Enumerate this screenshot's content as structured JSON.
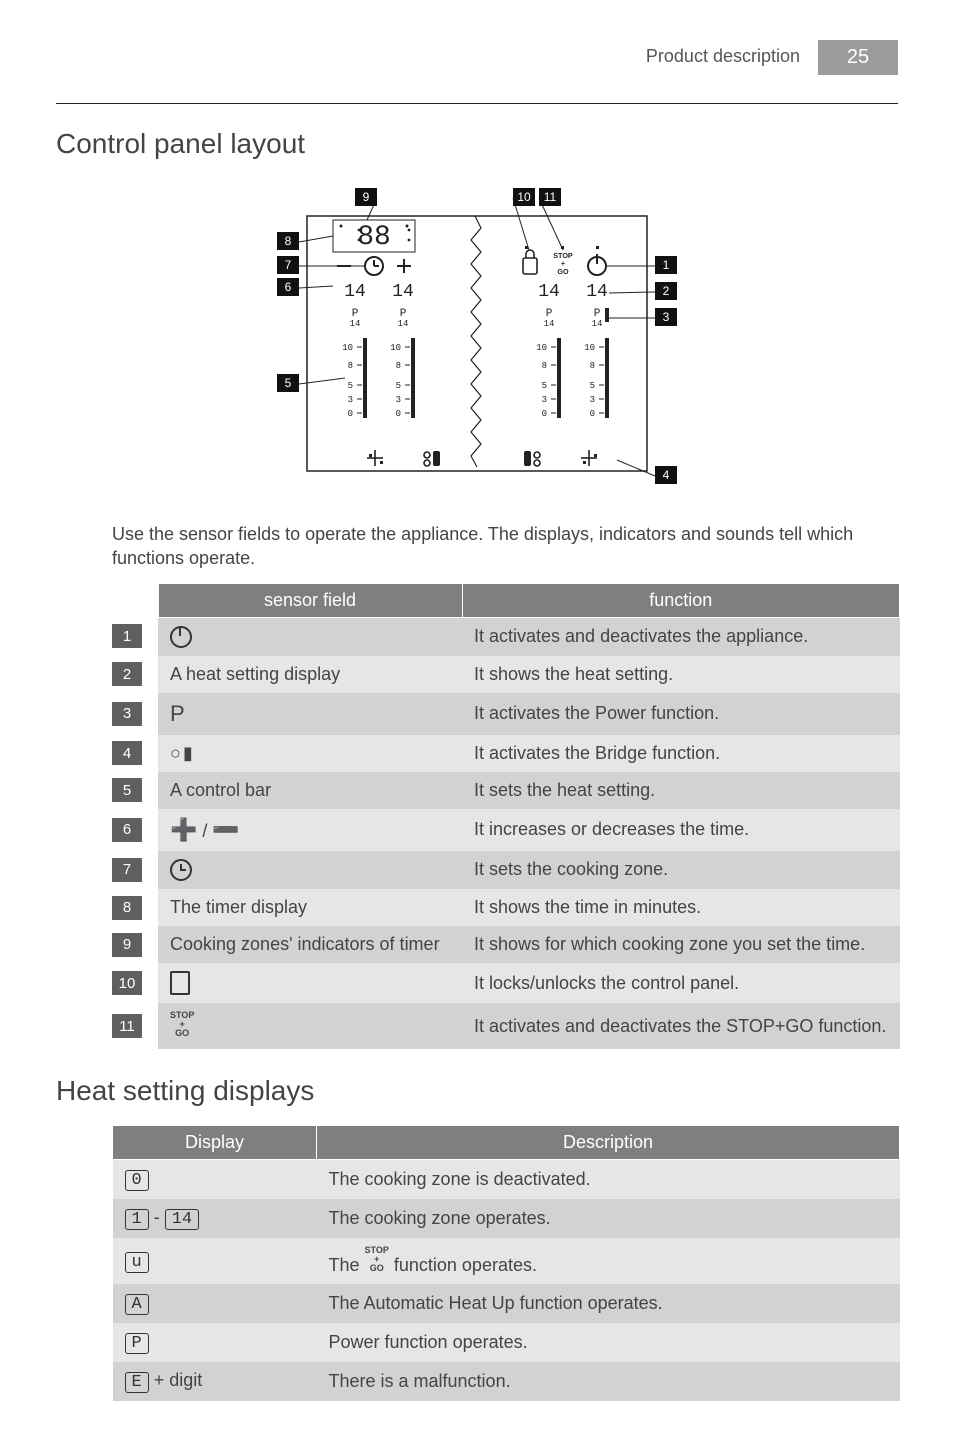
{
  "header": {
    "section": "Product description",
    "page": "25"
  },
  "sections": {
    "control_panel": "Control panel layout",
    "heat_display": "Heat setting displays"
  },
  "intro": "Use the sensor fields to operate the appliance. The displays, indicators and sounds tell which functions operate.",
  "sensor_table": {
    "head": {
      "sf": "sensor field",
      "fn": "function"
    },
    "rows": [
      {
        "n": "1",
        "sf_text": "",
        "fn": "It activates and deactivates the appliance."
      },
      {
        "n": "2",
        "sf_text": "A heat setting display",
        "fn": "It shows the heat setting."
      },
      {
        "n": "3",
        "sf_text": "P",
        "fn": "It activates the Power function."
      },
      {
        "n": "4",
        "sf_text": "",
        "fn": "It activates the Bridge function."
      },
      {
        "n": "5",
        "sf_text": "A control bar",
        "fn": "It sets the heat setting."
      },
      {
        "n": "6",
        "sf_text": " / ",
        "fn": "It increases or decreases the time."
      },
      {
        "n": "7",
        "sf_text": "",
        "fn": "It sets the cooking zone."
      },
      {
        "n": "8",
        "sf_text": "The timer display",
        "fn": "It shows the time in minutes."
      },
      {
        "n": "9",
        "sf_text": "Cooking zones' indicators of timer",
        "fn": "It shows for which cooking zone you set the time."
      },
      {
        "n": "10",
        "sf_text": "",
        "fn": "It locks/unlocks the control panel."
      },
      {
        "n": "11",
        "sf_text": "",
        "fn": "It activates and deactivates the STOP+GO function."
      }
    ]
  },
  "heat_table": {
    "head": {
      "disp": "Display",
      "desc": "Description"
    },
    "rows": [
      {
        "disp_text": "0",
        "desc": "The cooking zone is deactivated."
      },
      {
        "disp_text": "1 - 14",
        "desc": "The cooking zone operates."
      },
      {
        "disp_text": "u",
        "desc_pre": "The ",
        "desc_post": " function operates."
      },
      {
        "disp_text": "A",
        "desc": "The Automatic Heat Up function operates."
      },
      {
        "disp_text": "P",
        "desc": "Power function operates."
      },
      {
        "disp_text": "E + digit",
        "desc": "There is a malfunction."
      }
    ]
  },
  "diagram": {
    "callouts": [
      "1",
      "2",
      "3",
      "4",
      "5",
      "6",
      "7",
      "8",
      "9",
      "10",
      "11"
    ],
    "timer_preview": "88",
    "heat_segment": "14",
    "power_label": "P",
    "scale_marks": [
      "0",
      "3",
      "5",
      "8",
      "10"
    ],
    "scale_top": "14",
    "stopgo_lines": [
      "STOP",
      "+",
      "GO"
    ]
  }
}
